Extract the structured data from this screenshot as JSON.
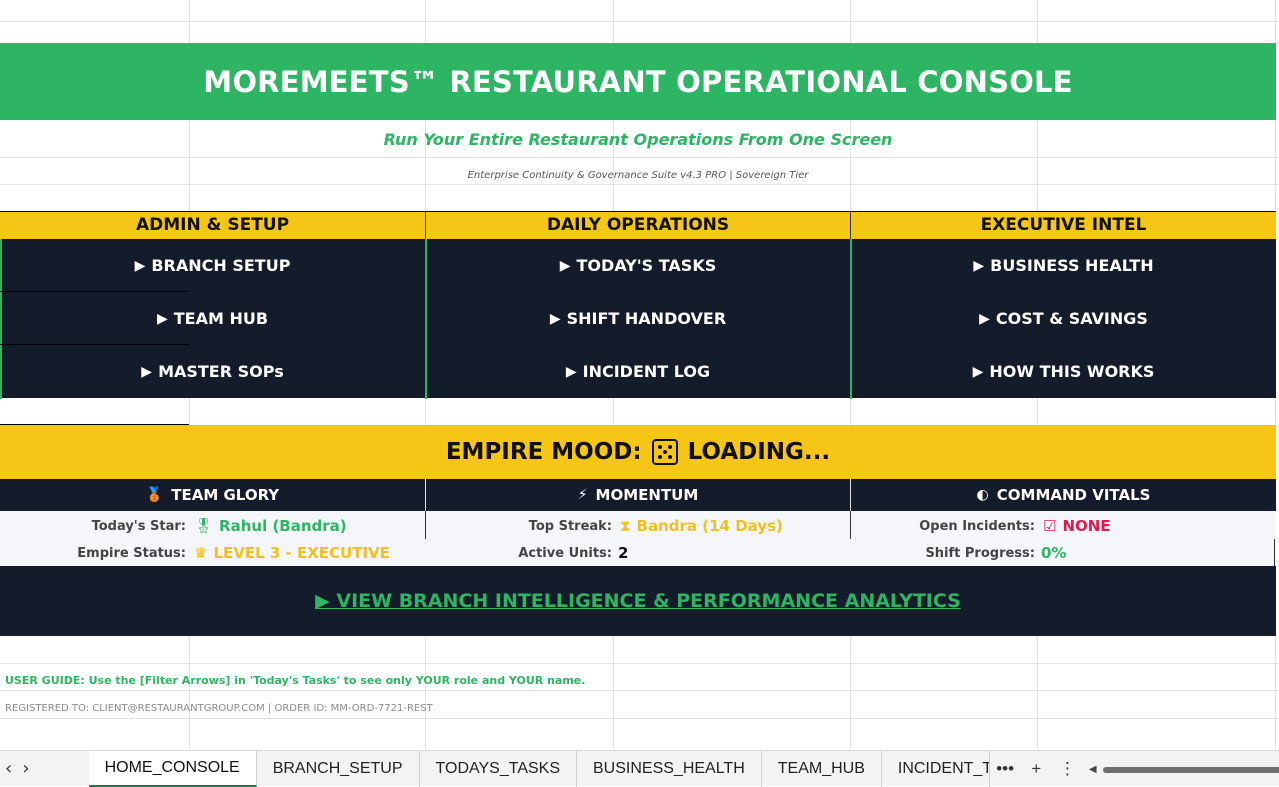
{
  "title": "MOREMEETS™ RESTAURANT OPERATIONAL CONSOLE",
  "tagline": "Run Your Entire Restaurant Operations From One Screen",
  "suite": "Enterprise Continuity & Governance Suite v4.3 PRO | Sovereign Tier",
  "columns": [
    {
      "header": "ADMIN & SETUP",
      "items": [
        "BRANCH SETUP",
        "TEAM HUB",
        "MASTER SOPs"
      ]
    },
    {
      "header": "DAILY OPERATIONS",
      "items": [
        "TODAY'S TASKS",
        "SHIFT HANDOVER",
        "INCIDENT LOG"
      ]
    },
    {
      "header": "EXECUTIVE INTEL",
      "items": [
        "BUSINESS HEALTH",
        "COST & SAVINGS",
        "HOW THIS WORKS"
      ]
    }
  ],
  "nav_arrow": "▶",
  "mood": {
    "label": "EMPIRE MOOD:",
    "value": "LOADING..."
  },
  "vitals": {
    "headers": [
      "TEAM GLORY",
      "MOMENTUM",
      "COMMAND VITALS"
    ],
    "team_glory": {
      "star_label": "Today's Star:",
      "star_value": "Rahul (Bandra)",
      "status_label": "Empire Status:",
      "status_value": "LEVEL 3 - EXECUTIVE"
    },
    "momentum": {
      "streak_label": "Top Streak:",
      "streak_value": "Bandra (14 Days)",
      "units_label": "Active Units:",
      "units_value": "2"
    },
    "command": {
      "incidents_label": "Open Incidents:",
      "incidents_value": "NONE",
      "progress_label": "Shift Progress:",
      "progress_value": "0%"
    }
  },
  "cta": "▶ VIEW BRANCH INTELLIGENCE & PERFORMANCE ANALYTICS",
  "guide": "USER GUIDE: Use the [Filter Arrows] in 'Today's Tasks' to see only YOUR role and YOUR name.",
  "registration": "REGISTERED TO: CLIENT@RESTAURANTGROUP.COM | ORDER ID: MM-ORD-7721-REST",
  "sheet_tabs": [
    "HOME_CONSOLE",
    "BRANCH_SETUP",
    "TODAYS_TASKS",
    "BUSINESS_HEALTH",
    "TEAM_HUB",
    "INCIDENT_TRACKER"
  ],
  "active_tab": "HOME_CONSOLE",
  "colors": {
    "green": "#2db563",
    "gold": "#f6c616",
    "navy": "#141b2a",
    "red": "#e0194e"
  }
}
